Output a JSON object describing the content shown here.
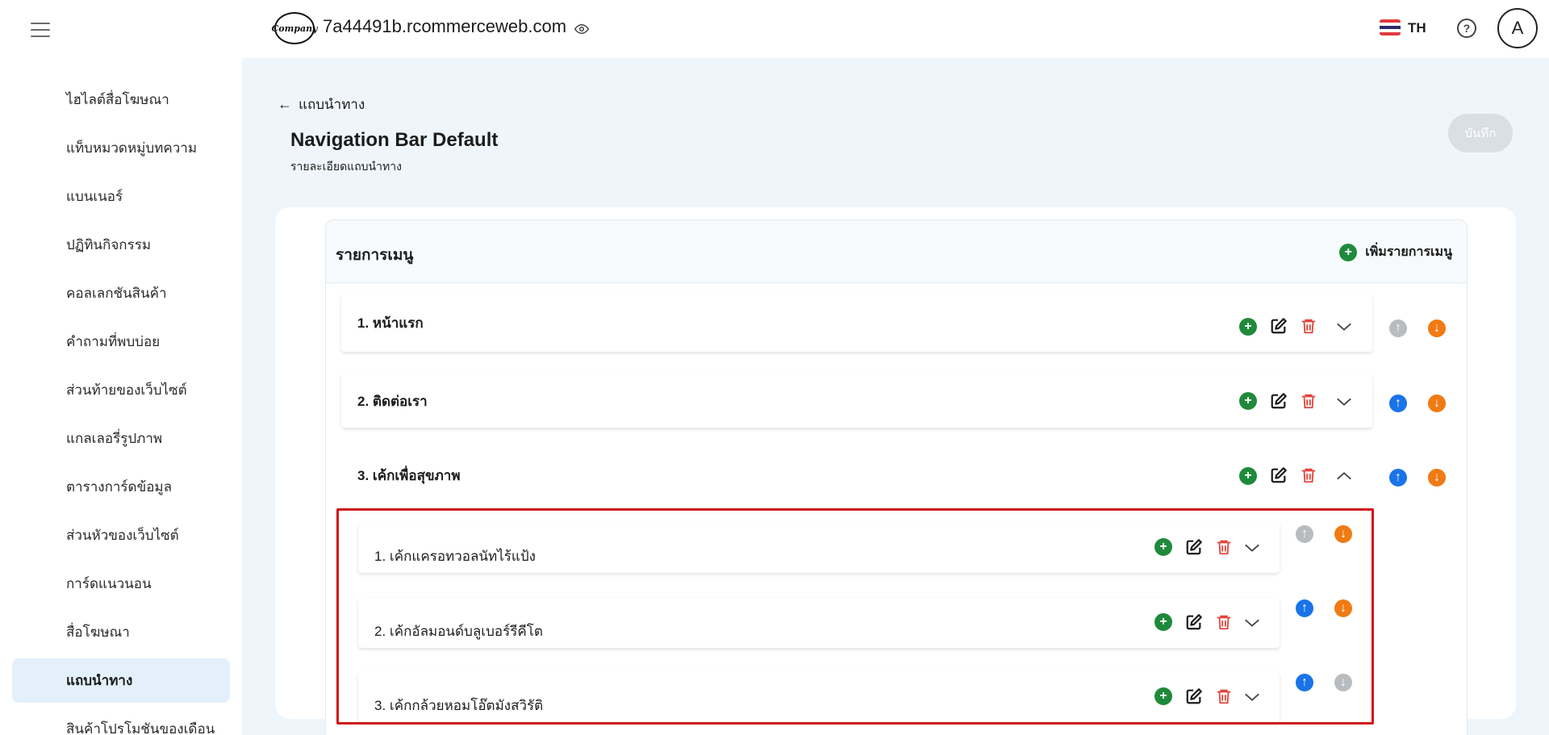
{
  "sidebar": {
    "items": [
      {
        "label": "ไฮไลต์สื่อโฆษณา"
      },
      {
        "label": "แท็บหมวดหมู่บทความ"
      },
      {
        "label": "แบนเนอร์"
      },
      {
        "label": "ปฏิทินกิจกรรม"
      },
      {
        "label": "คอลเลกชันสินค้า"
      },
      {
        "label": "คำถามที่พบบ่อย"
      },
      {
        "label": "ส่วนท้ายของเว็บไซต์"
      },
      {
        "label": "แกลเลอรี่รูปภาพ"
      },
      {
        "label": "ตารางการ์ดข้อมูล"
      },
      {
        "label": "ส่วนหัวของเว็บไซต์"
      },
      {
        "label": "การ์ดแนวนอน"
      },
      {
        "label": "สื่อโฆษณา"
      },
      {
        "label": "แถบนำทาง"
      },
      {
        "label": "สินค้าโปรโมชันของเดือน"
      }
    ]
  },
  "header": {
    "logo_text": "Company",
    "domain": "7a44491b.rcommerceweb.com",
    "lang": "TH",
    "help": "?",
    "avatar": "A"
  },
  "page": {
    "back_label": "แถบนำทาง",
    "title": "Navigation Bar Default",
    "subtitle": "รายละเอียดแถบนำทาง",
    "save_label": "บันทึก"
  },
  "menu": {
    "title": "รายการเมนู",
    "add_label": "เพิ่มรายการเมนู",
    "items": [
      {
        "label": "1. หน้าแรก"
      },
      {
        "label": "2. ติดต่อเรา"
      },
      {
        "label": "3. เค้กเพื่อสุขภาพ"
      }
    ],
    "subitems": [
      {
        "label": "1. เค้กแครอทวอลนัทไร้แป้ง"
      },
      {
        "label": "2. เค้กอัลมอนด์บลูเบอร์รีคีโต"
      },
      {
        "label": "3. เค้กกล้วยหอมโอ๊ตมังสวิรัติ"
      }
    ]
  },
  "colors": {
    "plus": "#1f8a3b",
    "edit": "#1c1c1c",
    "delete": "#e0463c",
    "up_active": "#1a73e8",
    "down_active": "#f07a13",
    "disabled": "#b9bcbf",
    "highlight": "#d0141a"
  }
}
